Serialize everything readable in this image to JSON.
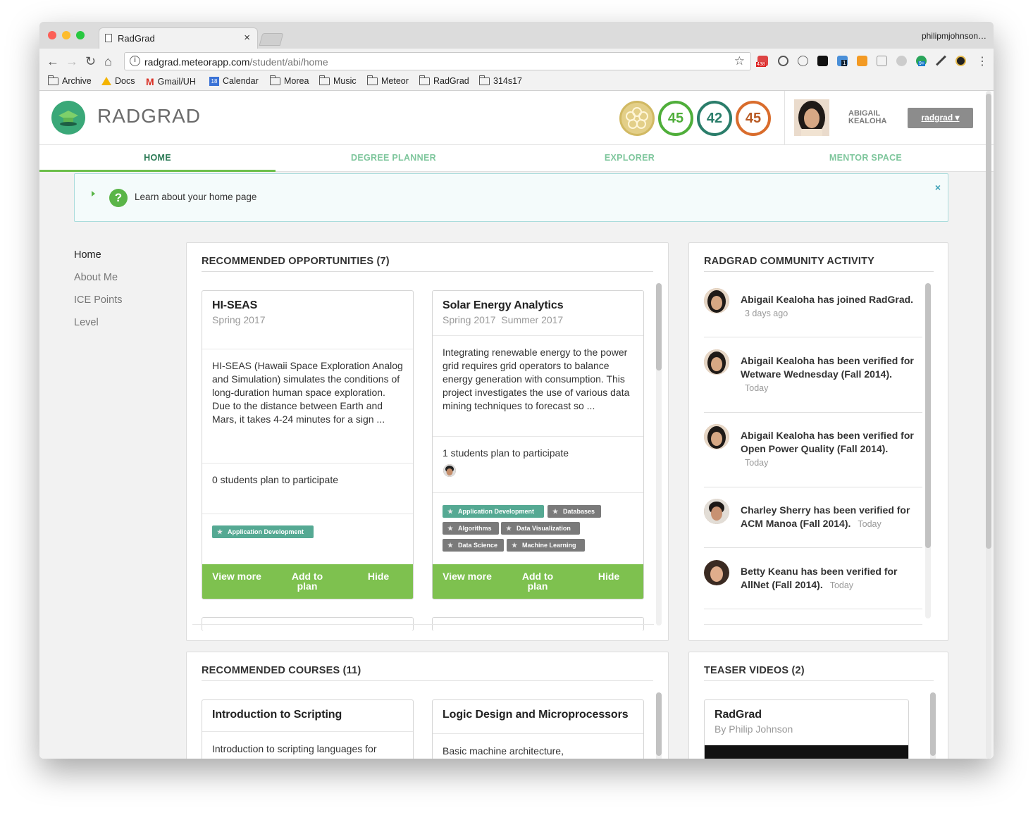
{
  "browser": {
    "tab_title": "RadGrad",
    "tab_close": "×",
    "profile": "philipmjohnson…",
    "url_host": "radgrad.meteorapp.com",
    "url_path": "/student/abi/home",
    "ext_badges": [
      "438",
      "1",
      "9+"
    ],
    "bookmarks": [
      "Archive",
      "Docs",
      "Gmail/UH",
      "Calendar",
      "Morea",
      "Music",
      "Meteor",
      "RadGrad",
      "314s17"
    ],
    "calendar_day": "18"
  },
  "header": {
    "logo": "RADGRAD",
    "scores": [
      {
        "value": "45",
        "color": "#4fae3a"
      },
      {
        "value": "42",
        "color": "#2a7d6a"
      },
      {
        "value": "45",
        "color": "#d96c2c"
      }
    ],
    "user_first": "ABIGAIL",
    "user_last": "KEALOHA",
    "user_button": "radgrad ▾"
  },
  "nav": {
    "items": [
      "HOME",
      "DEGREE PLANNER",
      "EXPLORER",
      "MENTOR SPACE"
    ],
    "active": "HOME"
  },
  "help": {
    "text": "Learn about your home page",
    "icon": "?",
    "close": "×"
  },
  "sidemenu": {
    "items": [
      "Home",
      "About Me",
      "ICE Points",
      "Level"
    ]
  },
  "opportunities": {
    "title": "RECOMMENDED OPPORTUNITIES (7)",
    "cards": [
      {
        "title": "HI-SEAS",
        "subtitle": "Spring 2017",
        "description": "HI-SEAS (Hawaii Space Exploration Analog and Simulation) simulates the conditions of long-duration human space exploration. Due to the distance between Earth and Mars, it takes 4-24 minutes for a sign ...",
        "participants": "0 students plan to participate",
        "tags": [
          "Application Development"
        ]
      },
      {
        "title": "Solar Energy Analytics",
        "subtitle": "Spring 2017  Summer 2017",
        "description": "Integrating renewable energy to the power grid requires grid operators to balance energy generation with consumption. This project investigates the use of various data mining techniques to forecast so ...",
        "participants": "1 students plan to participate",
        "tags": [
          "Application Development",
          "Databases",
          "Algorithms",
          "Data Visualization",
          "Data Science",
          "Machine Learning"
        ]
      }
    ],
    "actions": {
      "view": "View more",
      "add": "Add to plan",
      "hide": "Hide"
    }
  },
  "activity": {
    "title": "RADGRAD COMMUNITY ACTIVITY",
    "items": [
      {
        "text": "Abigail Kealoha has joined RadGrad.",
        "time": "3 days ago"
      },
      {
        "text": "Abigail Kealoha has been verified for Wetware Wednesday (Fall 2014).",
        "time": "Today"
      },
      {
        "text": "Abigail Kealoha has been verified for Open Power Quality (Fall 2014).",
        "time": "Today"
      },
      {
        "text": "Charley Sherry has been verified for ACM Manoa (Fall 2014).",
        "time": "Today"
      },
      {
        "text": "Betty Keanu has been verified for AllNet (Fall 2014).",
        "time": "Today"
      }
    ]
  },
  "courses": {
    "title": "RECOMMENDED COURSES (11)",
    "cards": [
      {
        "title": "Introduction to Scripting",
        "description": "Introduction to scripting languages for"
      },
      {
        "title": "Logic Design and Microprocessors",
        "description": "Basic machine architecture,"
      }
    ]
  },
  "videos": {
    "title": "TEASER VIDEOS (2)",
    "card": {
      "title": "RadGrad",
      "subtitle": "By Philip Johnson"
    }
  }
}
